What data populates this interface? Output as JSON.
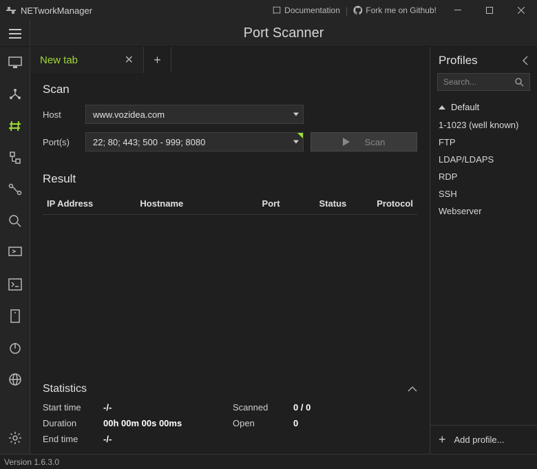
{
  "titlebar": {
    "app_name": "NETworkManager",
    "doc_label": "Documentation",
    "fork_label": "Fork me on Github!"
  },
  "page_title": "Port Scanner",
  "tab": {
    "label": "New tab"
  },
  "scan": {
    "heading": "Scan",
    "host_label": "Host",
    "host_value": "www.vozidea.com",
    "ports_label": "Port(s)",
    "ports_value": "22; 80; 443; 500 - 999; 8080",
    "scan_btn": "Scan"
  },
  "result": {
    "heading": "Result",
    "cols": {
      "ip": "IP Address",
      "hostname": "Hostname",
      "port": "Port",
      "status": "Status",
      "protocol": "Protocol"
    }
  },
  "stats": {
    "heading": "Statistics",
    "start_label": "Start time",
    "start_value": "-/-",
    "duration_label": "Duration",
    "duration_value": "00h 00m 00s 00ms",
    "end_label": "End time",
    "end_value": "-/-",
    "scanned_label": "Scanned",
    "scanned_value": "0 / 0",
    "open_label": "Open",
    "open_value": "0"
  },
  "profiles": {
    "heading": "Profiles",
    "search_placeholder": "Search...",
    "group": "Default",
    "items": [
      "1-1023 (well known)",
      "FTP",
      "LDAP/LDAPS",
      "RDP",
      "SSH",
      "Webserver"
    ],
    "add_label": "Add profile..."
  },
  "statusbar": {
    "version": "Version 1.6.3.0"
  }
}
